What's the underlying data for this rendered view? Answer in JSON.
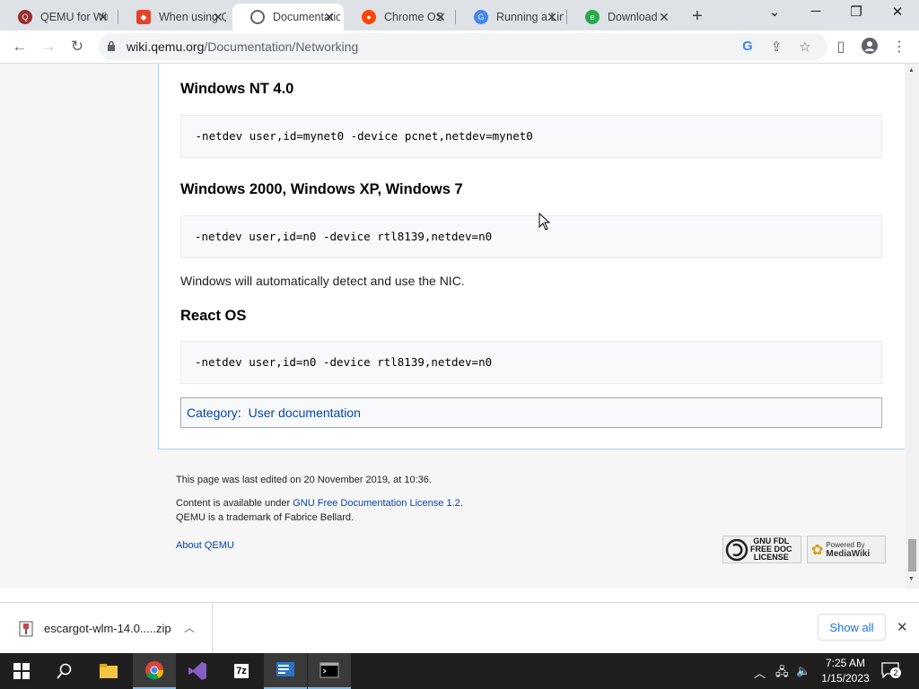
{
  "browser": {
    "tabs": [
      {
        "title": "QEMU for Windows",
        "favicon": "qemu-icon",
        "active": false
      },
      {
        "title": "When using QEMU",
        "favicon": "gitlab-icon",
        "active": false
      },
      {
        "title": "Documentation",
        "favicon": "globe-icon",
        "active": true
      },
      {
        "title": "Chrome OS",
        "favicon": "reddit-icon",
        "active": false
      },
      {
        "title": "Running a Linux",
        "favicon": "chrome-web-icon",
        "active": false
      },
      {
        "title": "Download",
        "favicon": "edge-icon",
        "active": false
      }
    ],
    "url_host": "wiki.qemu.org",
    "url_path": "/Documentation/Networking"
  },
  "article": {
    "sections": [
      {
        "heading": "Windows NT 4.0",
        "code": " -netdev user,id=mynet0 -device pcnet,netdev=mynet0"
      },
      {
        "heading": "Windows 2000, Windows XP, Windows 7",
        "code": "-netdev user,id=n0 -device rtl8139,netdev=n0",
        "note": "Windows will automatically detect and use the NIC."
      },
      {
        "heading": "React OS",
        "code": "-netdev user,id=n0 -device rtl8139,netdev=n0"
      }
    ],
    "category_label": "Category",
    "category_value": "User documentation"
  },
  "footer": {
    "last_edited": "This page was last edited on 20 November 2019, at 10:36.",
    "license_prefix": "Content is available under ",
    "license_link": "GNU Free Documentation License 1.2",
    "license_suffix": ".",
    "trademark": "QEMU is a trademark of Fabrice Bellard.",
    "about": "About QEMU",
    "badge_fdl": "GNU FDL FREE DOC LICENSE",
    "badge_mediawiki": "Powered By MediaWiki"
  },
  "downloads": {
    "file_name": "escargot-wlm-14.0.....zip",
    "show_all": "Show all"
  },
  "taskbar": {
    "time": "7:25 AM",
    "date": "1/15/2023",
    "notification_count": "2"
  }
}
